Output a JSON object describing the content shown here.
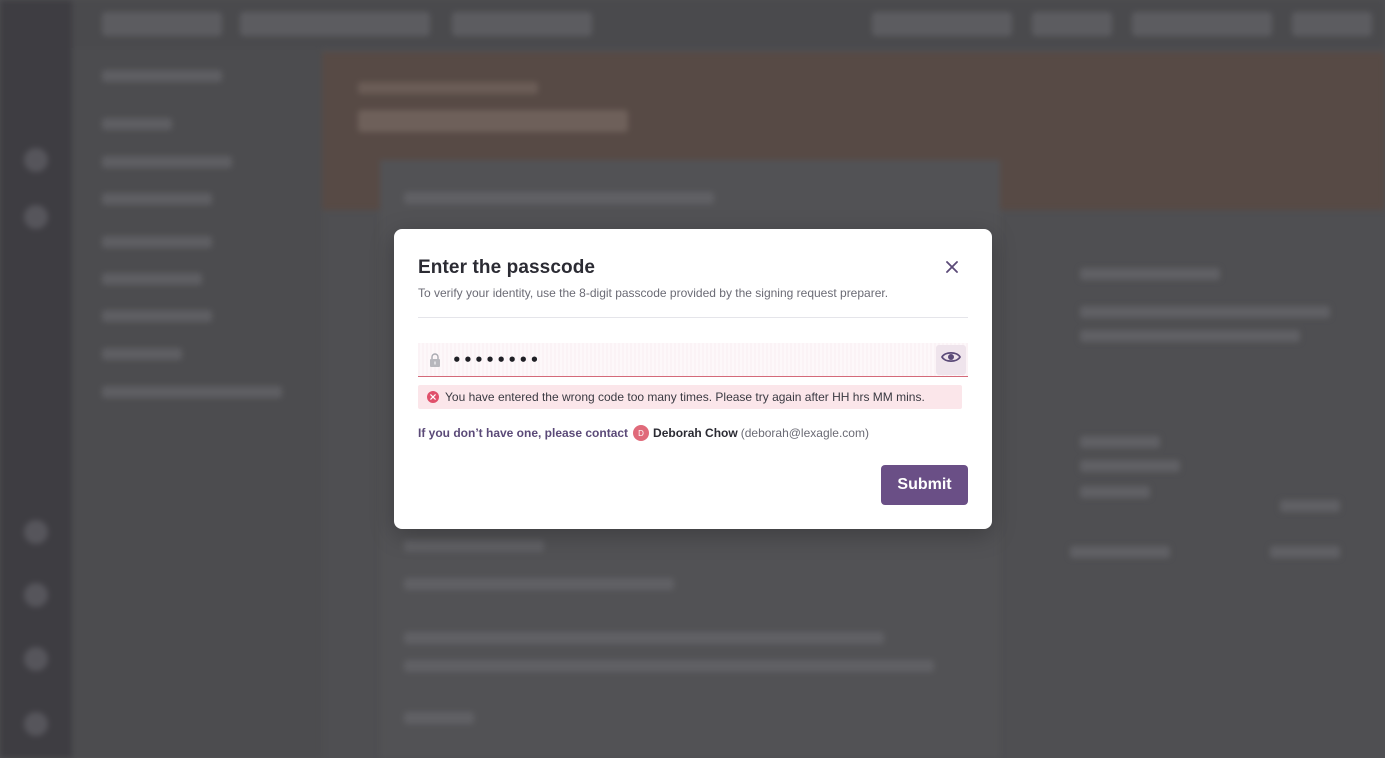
{
  "modal": {
    "title": "Enter the passcode",
    "subtitle": "To verify your identity, use the 8-digit passcode provided by the signing request preparer.",
    "passcode_value": "••••••••",
    "error_text": "You have entered the wrong code too many times. Please try again after HH hrs MM mins.",
    "contact": {
      "lead_text": "If you don’t have one, please contact",
      "avatar_initial": "D",
      "name": "Deborah Chow",
      "email": "(deborah@lexagle.com)"
    },
    "submit_label": "Submit"
  },
  "icons": {
    "close": "close-icon",
    "lock": "lock-icon",
    "eye": "eye-icon",
    "error": "error-x-icon"
  },
  "colors": {
    "accent": "#6a4f86",
    "error": "#e0506b",
    "error_bg": "#fbe6ea",
    "avatar": "#e06a7a",
    "overlay": "#4f4f52"
  }
}
